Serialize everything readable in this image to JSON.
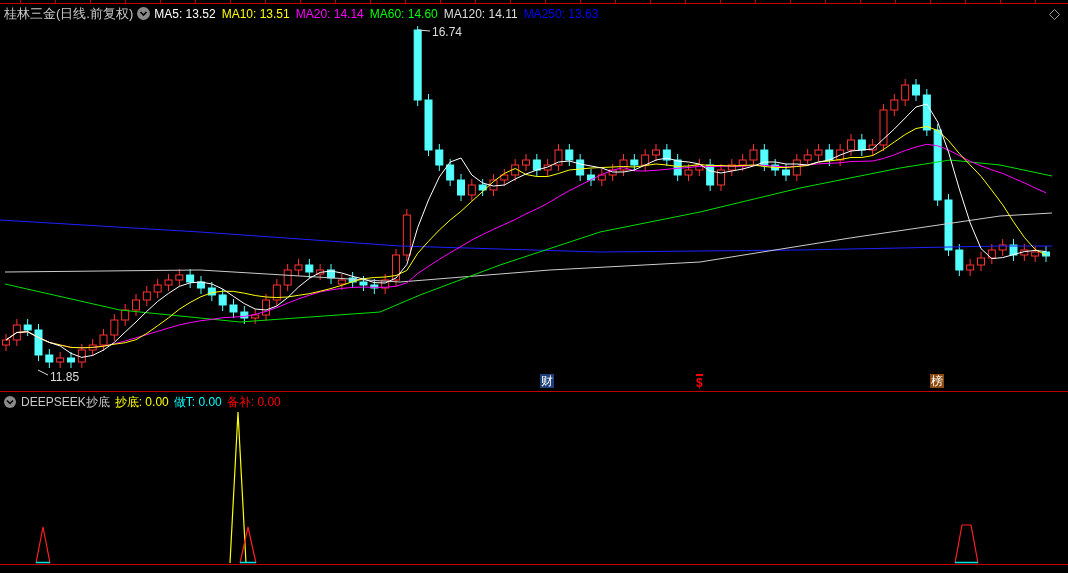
{
  "chart_header": {
    "title": "桂林三金(日线.前复权)",
    "indicators": [
      {
        "label": "MA5: 13.52",
        "color": "#ffffff"
      },
      {
        "label": "MA10: 13.51",
        "color": "#ffff00"
      },
      {
        "label": "MA20: 14.14",
        "color": "#ff00ff"
      },
      {
        "label": "MA60: 14.60",
        "color": "#00ff00"
      },
      {
        "label": "MA120: 14.11",
        "color": "#dddddd"
      },
      {
        "label": "MA250: 13.63",
        "color": "#0000ff"
      }
    ]
  },
  "price_labels": {
    "high": "16.74",
    "low": "11.85"
  },
  "event_markers": [
    {
      "label": "财",
      "kind": "badge",
      "color": "#1e3f7a"
    },
    {
      "label": "$",
      "kind": "arrow",
      "color": "#ff0000"
    },
    {
      "label": "榜",
      "kind": "badge",
      "color": "#8a4a10"
    }
  ],
  "indicator_header": {
    "title": "DEEPSEEK抄底",
    "values": [
      {
        "label": "抄底: 0.00",
        "color": "#ffff00"
      },
      {
        "label": "做T: 0.00",
        "color": "#00ffff"
      },
      {
        "label": "备补: 0.00",
        "color": "#ff0000"
      }
    ]
  }
}
